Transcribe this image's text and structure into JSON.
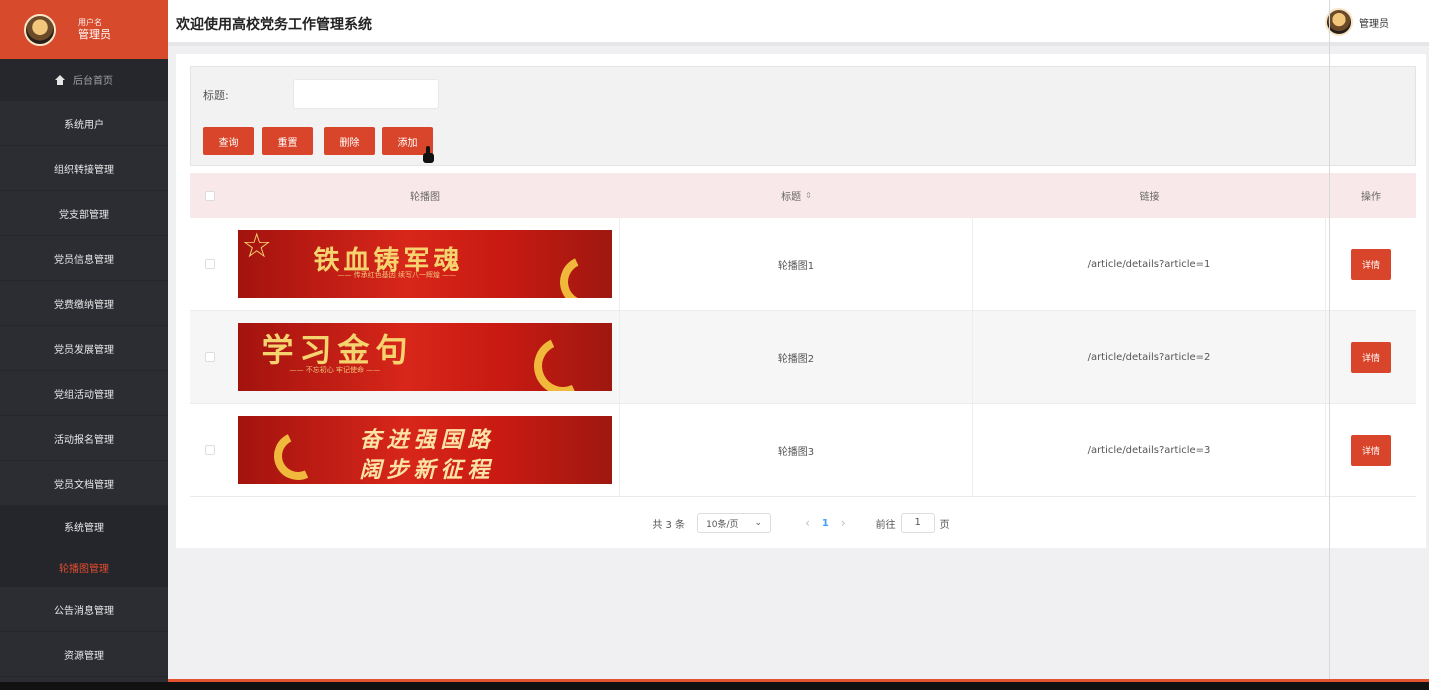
{
  "sidebar": {
    "user_label": "用户名",
    "user_name": "管理员",
    "home": "后台首页",
    "items": [
      "系统用户",
      "组织转接管理",
      "党支部管理",
      "党员信息管理",
      "党费缴纳管理",
      "党员发展管理",
      "党组活动管理",
      "活动报名管理",
      "党员文档管理"
    ],
    "system_group": {
      "label": "系统管理",
      "active_sub": "轮播图管理"
    },
    "bottom_items": [
      "公告消息管理",
      "资源管理"
    ]
  },
  "header": {
    "title": "欢迎使用高校党务工作管理系统",
    "user": "管理员"
  },
  "search": {
    "title_label": "标题:",
    "title_value": "",
    "buttons": {
      "query": "查询",
      "reset": "重置",
      "delete": "删除",
      "add": "添加"
    }
  },
  "table": {
    "headers": {
      "image": "轮播图",
      "title": "标题",
      "link": "链接",
      "operation": "操作"
    },
    "rows": [
      {
        "title": "轮播图1",
        "link": "/article/details?article=1",
        "detail": "详情",
        "banner_title": "铁血铸军魂",
        "banner_sub": "—— 传承红色基因 续写八一辉煌 ——"
      },
      {
        "title": "轮播图2",
        "link": "/article/details?article=2",
        "detail": "详情",
        "banner_title": "学习金句",
        "banner_sub": "—— 不忘初心 牢记使命 ——"
      },
      {
        "title": "轮播图3",
        "link": "/article/details?article=3",
        "detail": "详情",
        "banner_title": "奋进强国路",
        "banner_sub": "阔步新征程"
      }
    ]
  },
  "pagination": {
    "total": "共 3 条",
    "page_size": "10条/页",
    "current": "1",
    "goto_label": "前往",
    "goto_value": "1",
    "page_suffix": "页"
  },
  "colors": {
    "accent": "#d9452a",
    "sidebar_bg": "#2b2d33",
    "header_row": "#f9e8e9"
  }
}
